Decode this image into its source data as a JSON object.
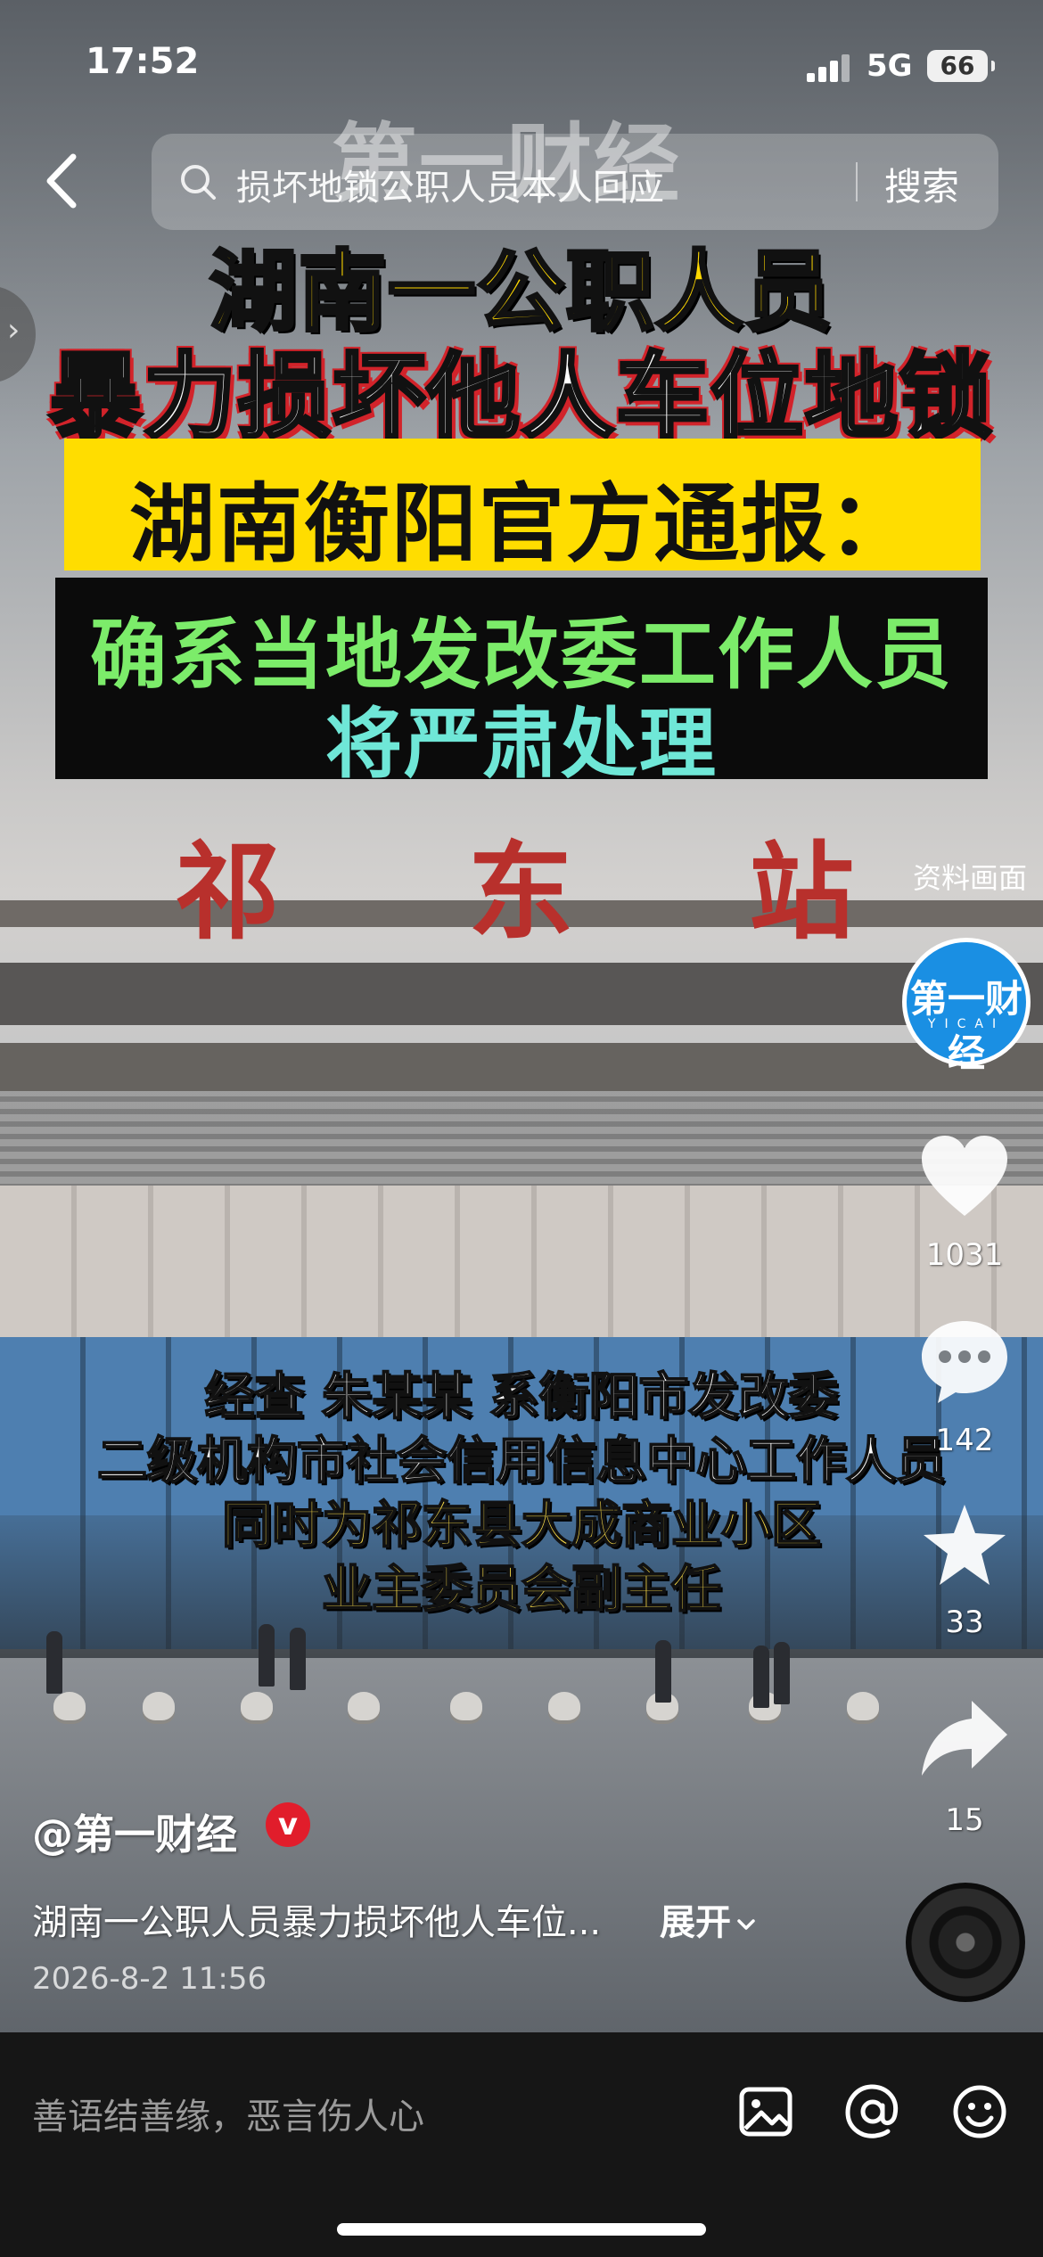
{
  "status_bar": {
    "time": "17:52",
    "network": "5G",
    "battery": "66"
  },
  "search": {
    "query": "损坏地锁公职人员本人回应",
    "button_label": "搜索"
  },
  "watermark": "第一财经",
  "video": {
    "headline_line1": "湖南一公职人员",
    "headline_line2": "暴力损坏他人车位地锁",
    "banner_yellow": "湖南衡阳官方通报：",
    "banner_black_line1": "确系当地发改委工作人员",
    "banner_black_line2": "将严肃处理",
    "station_sign": [
      "祁",
      "东",
      "站"
    ],
    "source_note": "资料画面",
    "subtitles": [
      "经查 朱某某 系衡阳市发改委",
      "二级机构市社会信用信息中心工作人员",
      "同时为祁东县大成商业小区",
      "业主委员会副主任"
    ]
  },
  "rail": {
    "avatar_text": "第一财经",
    "avatar_sub": "YICAI",
    "likes": "1031",
    "comments": "142",
    "favorites": "33",
    "shares": "15"
  },
  "post": {
    "author": "@第一财经",
    "verified": "v",
    "caption": "湖南一公职人员暴力损坏他人车位...",
    "expand_label": "展开",
    "date": "2026-8-2 11:56"
  },
  "comment_bar": {
    "placeholder": "善语结善缘，恶言伤人心"
  },
  "icons": [
    "back-arrow-icon",
    "search-icon",
    "heart-icon",
    "comment-icon",
    "star-icon",
    "share-icon",
    "image-icon",
    "at-icon",
    "emoji-icon",
    "music-disc-icon"
  ]
}
